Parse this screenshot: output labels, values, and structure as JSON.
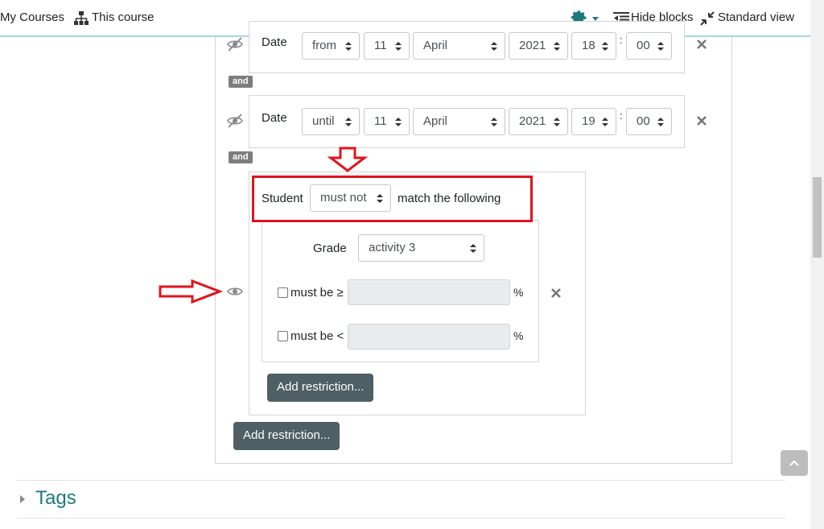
{
  "nav": {
    "my_courses": "My Courses",
    "this_course": "This course",
    "hide_blocks": "Hide blocks",
    "standard_view": "Standard view"
  },
  "conditions": [
    {
      "label": "Date",
      "direction": "from",
      "day": "11",
      "month": "April",
      "year": "2021",
      "hour": "18",
      "minute": "00"
    },
    {
      "label": "Date",
      "direction": "until",
      "day": "11",
      "month": "April",
      "year": "2021",
      "hour": "19",
      "minute": "00"
    }
  ],
  "time_separator": ":",
  "and_label": "and",
  "restriction_set": {
    "student_label": "Student",
    "must_value": "must not",
    "match_text": "match the following",
    "grade_label": "Grade",
    "grade_value": "activity 3",
    "min_label": "must be ≥",
    "max_label": "must be <",
    "percent": "%",
    "add_button": "Add restriction..."
  },
  "outer_add_button": "Add restriction...",
  "tags_title": "Tags",
  "colors": {
    "accent": "#1d7a7c",
    "annotation_red": "#e0141c",
    "button": "#4e5f66",
    "gear": "#1d7a7c"
  }
}
